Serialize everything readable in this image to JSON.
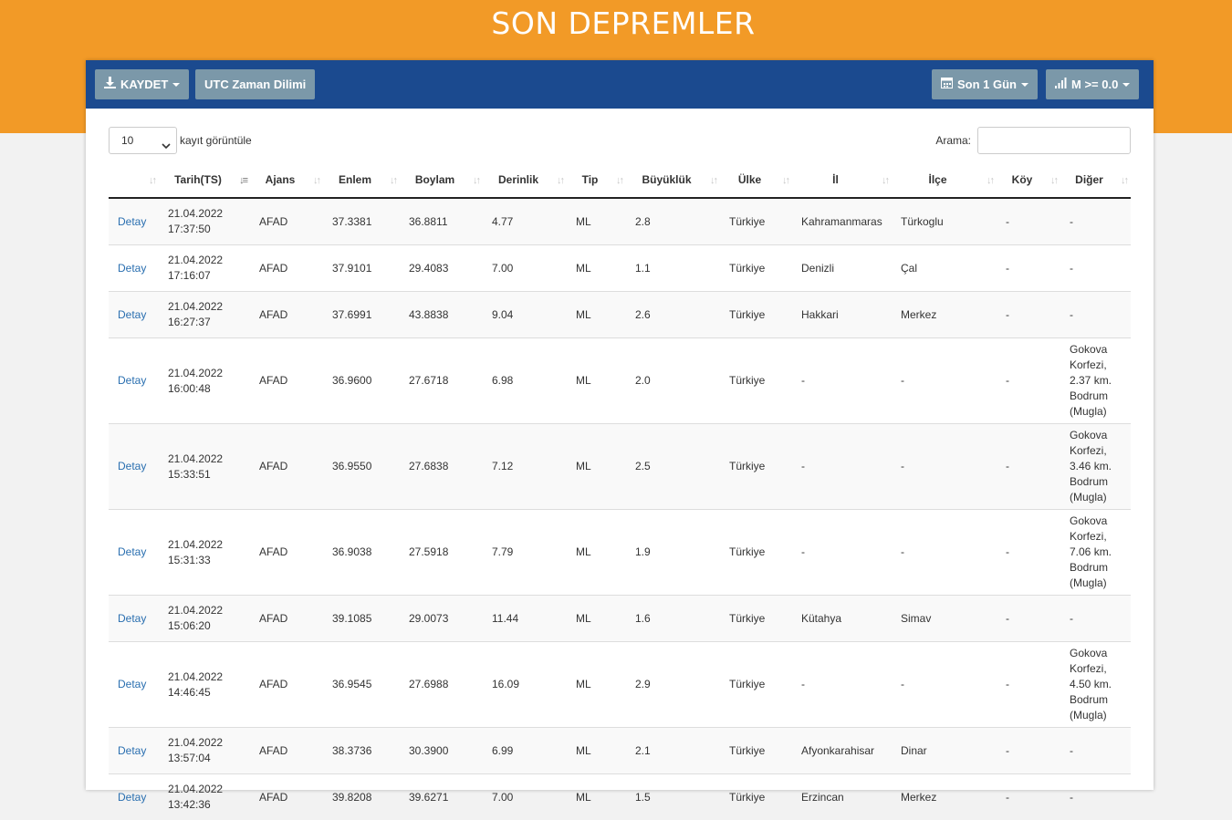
{
  "header": {
    "title": "SON DEPREMLER"
  },
  "toolbar": {
    "save_label": "KAYDET",
    "timezone_label": "UTC Zaman Dilimi",
    "period_label": "Son 1 Gün",
    "magnitude_label": "M >= 0.0"
  },
  "controls": {
    "page_length": "10",
    "page_length_label": "kayıt görüntüle",
    "search_label": "Arama:",
    "search_value": ""
  },
  "table": {
    "columns": [
      "",
      "Tarih(TS)",
      "Ajans",
      "Enlem",
      "Boylam",
      "Derinlik",
      "Tip",
      "Büyüklük",
      "Ülke",
      "İl",
      "İlçe",
      "Köy",
      "Diğer"
    ],
    "sorted_column": "Tarih(TS)",
    "rows": [
      {
        "link": "Detay",
        "date": "21.04.2022",
        "time": "17:37:50",
        "agency": "AFAD",
        "lat": "37.3381",
        "lon": "36.8811",
        "depth": "4.77",
        "type": "ML",
        "mag": "2.8",
        "country": "Türkiye",
        "province": "Kahramanmaras",
        "district": "Türkoglu",
        "village": "-",
        "other": "-"
      },
      {
        "link": "Detay",
        "date": "21.04.2022",
        "time": "17:16:07",
        "agency": "AFAD",
        "lat": "37.9101",
        "lon": "29.4083",
        "depth": "7.00",
        "type": "ML",
        "mag": "1.1",
        "country": "Türkiye",
        "province": "Denizli",
        "district": "Çal",
        "village": "-",
        "other": "-"
      },
      {
        "link": "Detay",
        "date": "21.04.2022",
        "time": "16:27:37",
        "agency": "AFAD",
        "lat": "37.6991",
        "lon": "43.8838",
        "depth": "9.04",
        "type": "ML",
        "mag": "2.6",
        "country": "Türkiye",
        "province": "Hakkari",
        "district": "Merkez",
        "village": "-",
        "other": "-"
      },
      {
        "link": "Detay",
        "date": "21.04.2022",
        "time": "16:00:48",
        "agency": "AFAD",
        "lat": "36.9600",
        "lon": "27.6718",
        "depth": "6.98",
        "type": "ML",
        "mag": "2.0",
        "country": "Türkiye",
        "province": "-",
        "district": "-",
        "village": "-",
        "other": "Gokova Korfezi, 2.37 km. Bodrum (Mugla)"
      },
      {
        "link": "Detay",
        "date": "21.04.2022",
        "time": "15:33:51",
        "agency": "AFAD",
        "lat": "36.9550",
        "lon": "27.6838",
        "depth": "7.12",
        "type": "ML",
        "mag": "2.5",
        "country": "Türkiye",
        "province": "-",
        "district": "-",
        "village": "-",
        "other": "Gokova Korfezi, 3.46 km. Bodrum (Mugla)"
      },
      {
        "link": "Detay",
        "date": "21.04.2022",
        "time": "15:31:33",
        "agency": "AFAD",
        "lat": "36.9038",
        "lon": "27.5918",
        "depth": "7.79",
        "type": "ML",
        "mag": "1.9",
        "country": "Türkiye",
        "province": "-",
        "district": "-",
        "village": "-",
        "other": "Gokova Korfezi, 7.06 km. Bodrum (Mugla)"
      },
      {
        "link": "Detay",
        "date": "21.04.2022",
        "time": "15:06:20",
        "agency": "AFAD",
        "lat": "39.1085",
        "lon": "29.0073",
        "depth": "11.44",
        "type": "ML",
        "mag": "1.6",
        "country": "Türkiye",
        "province": "Kütahya",
        "district": "Simav",
        "village": "-",
        "other": "-"
      },
      {
        "link": "Detay",
        "date": "21.04.2022",
        "time": "14:46:45",
        "agency": "AFAD",
        "lat": "36.9545",
        "lon": "27.6988",
        "depth": "16.09",
        "type": "ML",
        "mag": "2.9",
        "country": "Türkiye",
        "province": "-",
        "district": "-",
        "village": "-",
        "other": "Gokova Korfezi, 4.50 km. Bodrum (Mugla)"
      },
      {
        "link": "Detay",
        "date": "21.04.2022",
        "time": "13:57:04",
        "agency": "AFAD",
        "lat": "38.3736",
        "lon": "30.3900",
        "depth": "6.99",
        "type": "ML",
        "mag": "2.1",
        "country": "Türkiye",
        "province": "Afyonkarahisar",
        "district": "Dinar",
        "village": "-",
        "other": "-"
      },
      {
        "link": "Detay",
        "date": "21.04.2022",
        "time": "13:42:36",
        "agency": "AFAD",
        "lat": "39.8208",
        "lon": "39.6271",
        "depth": "7.00",
        "type": "ML",
        "mag": "1.5",
        "country": "Türkiye",
        "province": "Erzincan",
        "district": "Merkez",
        "village": "-",
        "other": "-"
      }
    ]
  },
  "colors": {
    "hero": "#f29a27",
    "toolbar": "#1b4a8f",
    "button": "#7b98a9",
    "link": "#2a6fb0"
  },
  "icons": {
    "save": "download-icon",
    "period": "calendar-icon",
    "magnitude": "signal-bars-icon",
    "sort": "sort-arrows-icon"
  }
}
